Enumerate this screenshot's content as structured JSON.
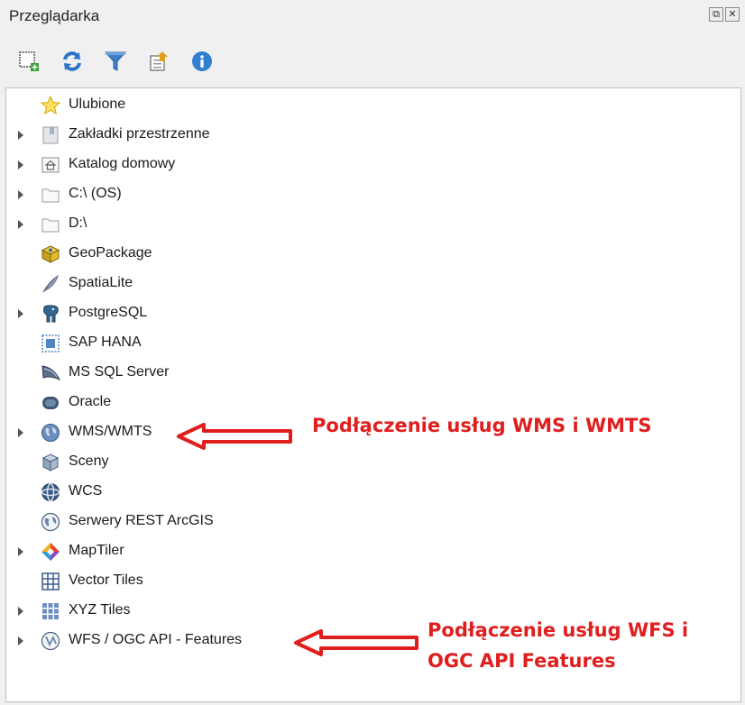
{
  "panel": {
    "title": "Przeglądarka",
    "window_buttons": [
      "⧉",
      "✕"
    ]
  },
  "toolbar": {
    "buttons": [
      {
        "icon": "add-layer-icon"
      },
      {
        "icon": "refresh-icon"
      },
      {
        "icon": "filter-icon"
      },
      {
        "icon": "collapse-all-icon"
      },
      {
        "icon": "info-icon"
      }
    ]
  },
  "tree": {
    "items": [
      {
        "label": "Ulubione",
        "icon": "star-icon",
        "expandable": false
      },
      {
        "label": "Zakładki przestrzenne",
        "icon": "bookmark-icon",
        "expandable": true
      },
      {
        "label": "Katalog domowy",
        "icon": "home-folder-icon",
        "expandable": true
      },
      {
        "label": "C:\\ (OS)",
        "icon": "folder-icon",
        "expandable": true
      },
      {
        "label": "D:\\",
        "icon": "folder-icon",
        "expandable": true
      },
      {
        "label": "GeoPackage",
        "icon": "geopackage-icon",
        "expandable": false
      },
      {
        "label": "SpatiaLite",
        "icon": "feather-icon",
        "expandable": false
      },
      {
        "label": "PostgreSQL",
        "icon": "elephant-icon",
        "expandable": true
      },
      {
        "label": "SAP HANA",
        "icon": "sap-hana-icon",
        "expandable": false
      },
      {
        "label": "MS SQL Server",
        "icon": "mssql-icon",
        "expandable": false
      },
      {
        "label": "Oracle",
        "icon": "oracle-icon",
        "expandable": false
      },
      {
        "label": "WMS/WMTS",
        "icon": "globe-icon",
        "expandable": true
      },
      {
        "label": "Sceny",
        "icon": "cube-icon",
        "expandable": false
      },
      {
        "label": "WCS",
        "icon": "wcs-globe-icon",
        "expandable": false
      },
      {
        "label": "Serwery REST ArcGIS",
        "icon": "arcgis-globe-icon",
        "expandable": false
      },
      {
        "label": "MapTiler",
        "icon": "maptiler-icon",
        "expandable": true
      },
      {
        "label": "Vector Tiles",
        "icon": "vector-tiles-icon",
        "expandable": false
      },
      {
        "label": "XYZ Tiles",
        "icon": "xyz-tiles-icon",
        "expandable": true
      },
      {
        "label": "WFS / OGC API - Features",
        "icon": "wfs-globe-icon",
        "expandable": true
      }
    ]
  },
  "annotations": {
    "wms": "Podłączenie usług WMS i WMTS",
    "wfs_line1": "Podłączenie usług WFS i",
    "wfs_line2": "OGC API Features",
    "color": "#e01e1e"
  }
}
